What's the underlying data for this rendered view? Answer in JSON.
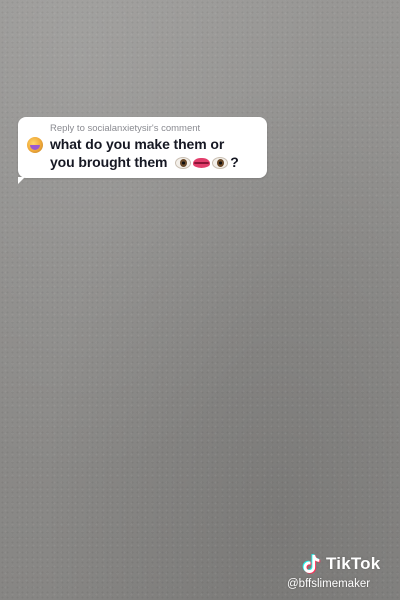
{
  "reply": {
    "header": "Reply to socialanxietysir's comment",
    "line1": "what do you make them or",
    "line2": "you brought them",
    "trailing": "?",
    "emojis": [
      "eye-emoji",
      "lips-emoji",
      "eye-emoji"
    ]
  },
  "watermark": {
    "brand": "TikTok",
    "username": "@bffslimemaker"
  },
  "colors": {
    "bubble_bg": "#ffffff",
    "comment_text": "#161823",
    "header_text": "#8a8b91",
    "background": "#8f8e8c",
    "watermark_text": "#ffffff"
  }
}
